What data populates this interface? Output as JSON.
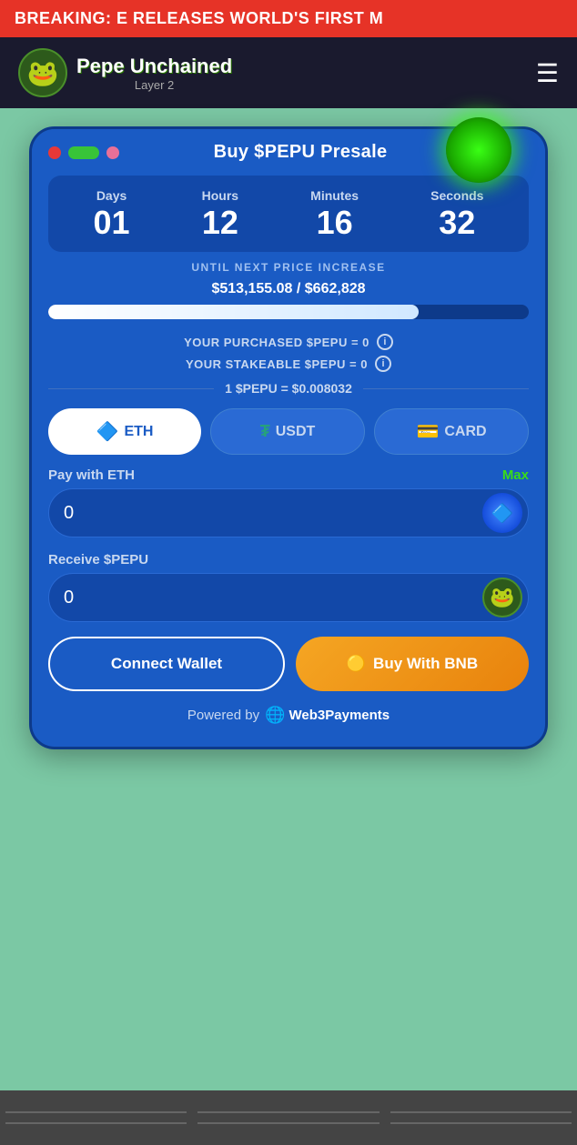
{
  "breaking": {
    "text": "BREAKING:   E RELEASES WORLD'S FIRST M"
  },
  "header": {
    "logo_emoji": "🐸",
    "brand_first": "Pepe ",
    "brand_second": "Unchained",
    "layer": "Layer 2",
    "hamburger": "☰"
  },
  "card": {
    "title": "Buy $PEPU Presale",
    "countdown": {
      "days_label": "Days",
      "days_value": "01",
      "hours_label": "Hours",
      "hours_value": "12",
      "minutes_label": "Minutes",
      "minutes_value": "16",
      "seconds_label": "Seconds",
      "seconds_value": "32"
    },
    "until_text": "UNTIL NEXT PRICE INCREASE",
    "progress_amount": "$513,155.08 / $662,828",
    "progress_pct": 77,
    "purchased_label": "YOUR PURCHASED $PEPU = 0",
    "stakeable_label": "YOUR STAKEABLE $PEPU = 0",
    "price_label": "1 $PEPU = $0.008032",
    "info_icon": "i",
    "tabs": [
      {
        "id": "eth",
        "label": "ETH",
        "icon": "🔷",
        "active": true
      },
      {
        "id": "usdt",
        "label": "USDT",
        "icon": "₮",
        "active": false
      },
      {
        "id": "card",
        "label": "CARD",
        "icon": "💳",
        "active": false
      }
    ],
    "pay_label": "Pay with ETH",
    "max_label": "Max",
    "pay_placeholder": "0",
    "receive_label": "Receive $PEPU",
    "receive_placeholder": "0",
    "connect_btn": "Connect Wallet",
    "buy_btn": "Buy With BNB",
    "bnb_icon": "🟡",
    "powered_by": "Powered by",
    "web3_brand": "Web3Payments",
    "web3_icon": "🌐"
  }
}
